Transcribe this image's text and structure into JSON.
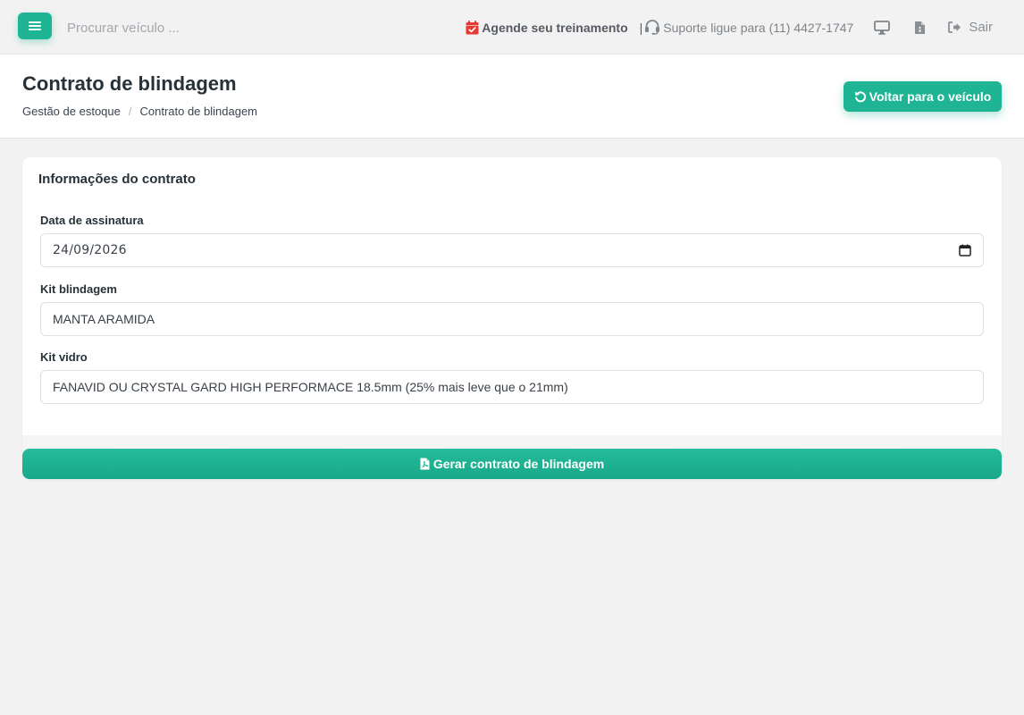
{
  "topbar": {
    "search_placeholder": "Procurar veículo ...",
    "agende_label": "Agende seu treinamento",
    "separator": "|",
    "suporte_label": "Suporte ligue para (11) 4427-1747",
    "sair_label": "Sair",
    "icons": [
      "menu-icon",
      "calendar-check-icon",
      "headset-icon",
      "monitor-icon",
      "file-icon",
      "sign-out-icon"
    ]
  },
  "header": {
    "title": "Contrato de blindagem",
    "breadcrumb": [
      "Gestão de estoque",
      "Contrato de blindagem"
    ],
    "breadcrumb_separator": "/",
    "back_button_label": "Voltar para o veículo"
  },
  "form": {
    "card_title": "Informações do contrato",
    "data_assinatura": {
      "label": "Data de assinatura",
      "value": "24/09/2026"
    },
    "kit_blindagem": {
      "label": "Kit blindagem",
      "value": "MANTA ARAMIDA"
    },
    "kit_vidro": {
      "label": "Kit vidro",
      "value": "FANAVID OU CRYSTAL GARD HIGH PERFORMACE 18.5mm (25% mais leve que o 21mm)"
    }
  },
  "actions": {
    "generate_label": "Gerar contrato de blindagem"
  },
  "colors": {
    "accent": "#1fb594",
    "calendar_icon": "#e53935",
    "background": "#f2f2f2"
  }
}
